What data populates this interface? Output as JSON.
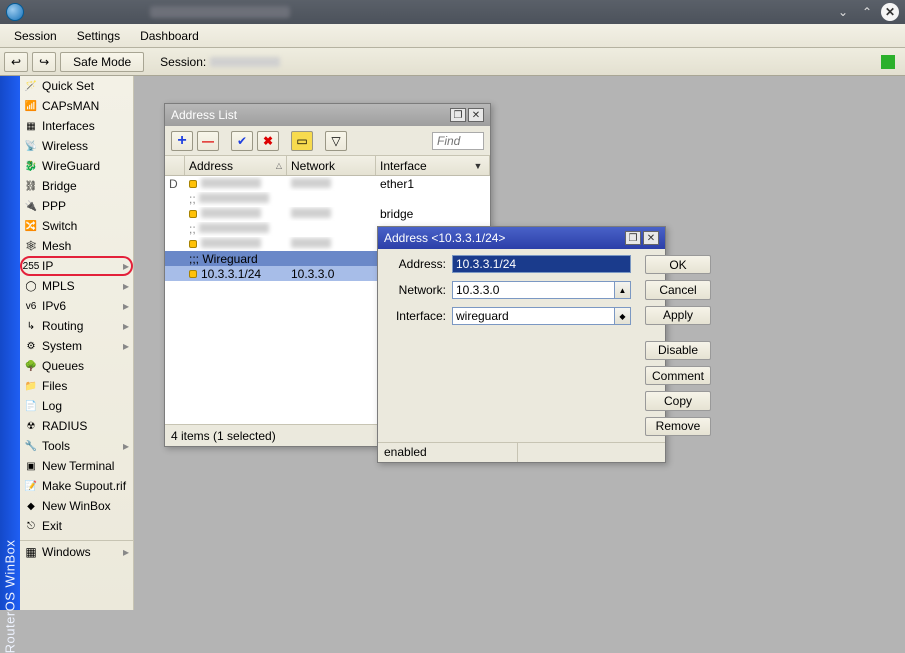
{
  "titlebar": {
    "control_down": "⌄",
    "control_up": "⌃",
    "control_close": "✕"
  },
  "menubar": {
    "items": [
      "Session",
      "Settings",
      "Dashboard"
    ]
  },
  "toolbar": {
    "undo_icon": "↩",
    "redo_icon": "↪",
    "safe_mode": "Safe Mode",
    "session_label": "Session:"
  },
  "sidebar_title": "RouterOS WinBox",
  "sidebar": {
    "items": [
      {
        "label": "Quick Set",
        "icon": "🪄",
        "sub": false
      },
      {
        "label": "CAPsMAN",
        "icon": "📶",
        "sub": false
      },
      {
        "label": "Interfaces",
        "icon": "▦",
        "sub": false
      },
      {
        "label": "Wireless",
        "icon": "📡",
        "sub": false
      },
      {
        "label": "WireGuard",
        "icon": "🐉",
        "sub": false
      },
      {
        "label": "Bridge",
        "icon": "⛓",
        "sub": false
      },
      {
        "label": "PPP",
        "icon": "🔌",
        "sub": false
      },
      {
        "label": "Switch",
        "icon": "🔀",
        "sub": false
      },
      {
        "label": "Mesh",
        "icon": "🕸",
        "sub": false
      },
      {
        "label": "IP",
        "icon": "255",
        "sub": true,
        "marked": true
      },
      {
        "label": "MPLS",
        "icon": "◯",
        "sub": true
      },
      {
        "label": "IPv6",
        "icon": "v6",
        "sub": true
      },
      {
        "label": "Routing",
        "icon": "↳",
        "sub": true
      },
      {
        "label": "System",
        "icon": "⚙",
        "sub": true
      },
      {
        "label": "Queues",
        "icon": "🌳",
        "sub": false
      },
      {
        "label": "Files",
        "icon": "📁",
        "sub": false
      },
      {
        "label": "Log",
        "icon": "📄",
        "sub": false
      },
      {
        "label": "RADIUS",
        "icon": "☢",
        "sub": false
      },
      {
        "label": "Tools",
        "icon": "🔧",
        "sub": true
      },
      {
        "label": "New Terminal",
        "icon": "▣",
        "sub": false
      },
      {
        "label": "Make Supout.rif",
        "icon": "📝",
        "sub": false
      },
      {
        "label": "New WinBox",
        "icon": "◆",
        "sub": false
      },
      {
        "label": "Exit",
        "icon": "⎋",
        "sub": false
      }
    ],
    "windows_label": "Windows"
  },
  "address_list": {
    "title": "Address List",
    "find_placeholder": "Find",
    "columns": {
      "address": "Address",
      "network": "Network",
      "interface": "Interface"
    },
    "rows": [
      {
        "flag": "D",
        "addr_blur": true,
        "net_blur": true,
        "iface": "ether1"
      },
      {
        "comment": true,
        "label_blur": true
      },
      {
        "addr_blur": true,
        "net_blur": true,
        "iface": "bridge"
      },
      {
        "comment": true,
        "label_blur": true
      },
      {
        "addr_blur": true,
        "net_blur": true,
        "iface": ""
      },
      {
        "comment": true,
        "group_sel": true,
        "label": ";;; Wireguard"
      },
      {
        "sel": true,
        "addr": "10.3.3.1/24",
        "net": "10.3.3.0",
        "iface": ""
      }
    ],
    "status": "4 items (1 selected)"
  },
  "address_dialog": {
    "title": "Address <10.3.3.1/24>",
    "address_label": "Address:",
    "address_value": "10.3.3.1/24",
    "network_label": "Network:",
    "network_value": "10.3.3.0",
    "interface_label": "Interface:",
    "interface_value": "wireguard",
    "buttons": {
      "ok": "OK",
      "cancel": "Cancel",
      "apply": "Apply",
      "disable": "Disable",
      "comment": "Comment",
      "copy": "Copy",
      "remove": "Remove"
    },
    "status": "enabled"
  }
}
